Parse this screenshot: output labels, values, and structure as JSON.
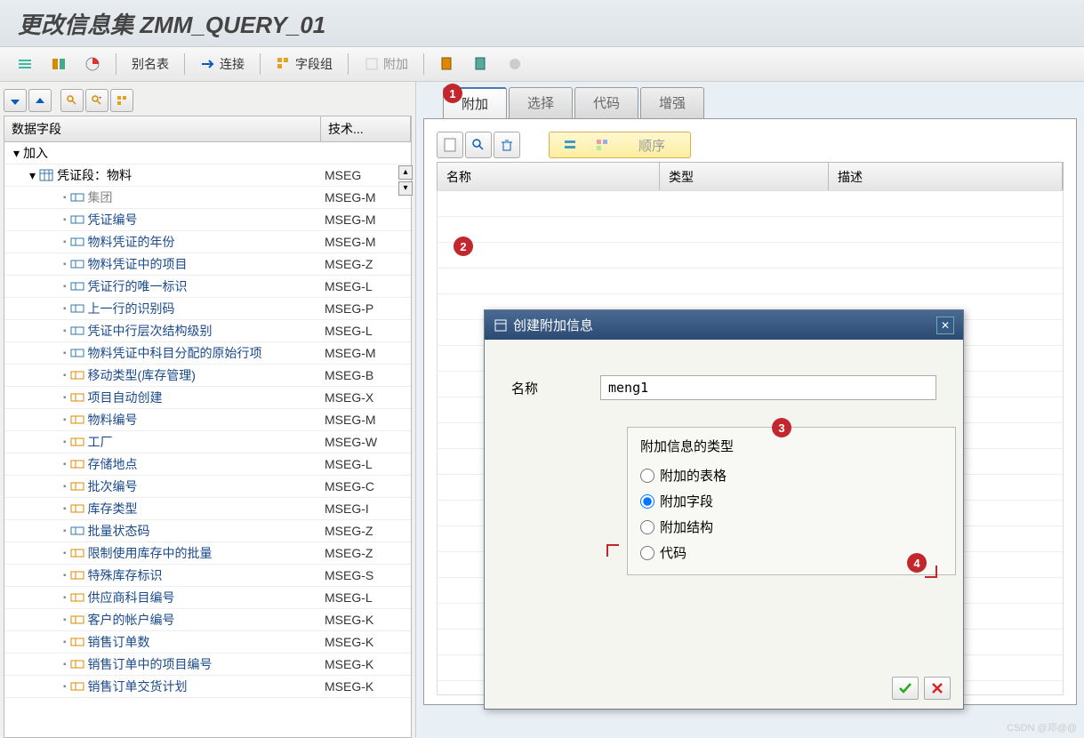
{
  "title": "更改信息集 ZMM_QUERY_01",
  "toolbar": {
    "alias_table": "别名表",
    "connect": "连接",
    "field_group": "字段组",
    "attach": "附加"
  },
  "left": {
    "header_left": "数据字段",
    "header_right": "技术...",
    "root": "加入",
    "mseg": {
      "label": "凭证段：物料",
      "tech": "MSEG"
    },
    "rows": [
      {
        "label": "集团",
        "tech": "MSEG-M",
        "gray": true
      },
      {
        "label": "凭证编号",
        "tech": "MSEG-M",
        "link": true
      },
      {
        "label": "物料凭证的年份",
        "tech": "MSEG-M",
        "link": true
      },
      {
        "label": "物料凭证中的项目",
        "tech": "MSEG-Z",
        "link": true
      },
      {
        "label": "凭证行的唯一标识",
        "tech": "MSEG-L",
        "link": true
      },
      {
        "label": "上一行的识别码",
        "tech": "MSEG-P",
        "link": true
      },
      {
        "label": "凭证中行层次结构级别",
        "tech": "MSEG-L",
        "link": true
      },
      {
        "label": "物料凭证中科目分配的原始行项",
        "tech": "MSEG-M",
        "link": true
      },
      {
        "label": "移动类型(库存管理)",
        "tech": "MSEG-B",
        "link": true,
        "iconAlt": true
      },
      {
        "label": "项目自动创建",
        "tech": "MSEG-X",
        "link": true,
        "iconAlt": true
      },
      {
        "label": "物料编号",
        "tech": "MSEG-M",
        "link": true,
        "iconAlt": true
      },
      {
        "label": "工厂",
        "tech": "MSEG-W",
        "link": true,
        "iconAlt": true
      },
      {
        "label": "存储地点",
        "tech": "MSEG-L",
        "link": true,
        "iconAlt": true
      },
      {
        "label": "批次编号",
        "tech": "MSEG-C",
        "link": true,
        "iconAlt": true
      },
      {
        "label": "库存类型",
        "tech": "MSEG-I",
        "link": true,
        "iconAlt": true
      },
      {
        "label": "批量状态码",
        "tech": "MSEG-Z",
        "link": true
      },
      {
        "label": "限制使用库存中的批量",
        "tech": "MSEG-Z",
        "link": true,
        "iconAlt": true
      },
      {
        "label": "特殊库存标识",
        "tech": "MSEG-S",
        "link": true,
        "iconAlt": true
      },
      {
        "label": "供应商科目编号",
        "tech": "MSEG-L",
        "link": true,
        "iconAlt": true
      },
      {
        "label": "客户的帐户编号",
        "tech": "MSEG-K",
        "link": true,
        "iconAlt": true
      },
      {
        "label": "销售订单数",
        "tech": "MSEG-K",
        "link": true,
        "iconAlt": true
      },
      {
        "label": "销售订单中的项目编号",
        "tech": "MSEG-K",
        "link": true,
        "iconAlt": true
      },
      {
        "label": "销售订单交货计划",
        "tech": "MSEG-K",
        "link": true,
        "iconAlt": true
      }
    ]
  },
  "tabs": [
    "附加",
    "选择",
    "代码",
    "增强"
  ],
  "grid": {
    "cols": [
      "名称",
      "类型",
      "描述"
    ],
    "seq": "顺序"
  },
  "dialog": {
    "title": "创建附加信息",
    "name_label": "名称",
    "name_value": "meng1",
    "group_title": "附加信息的类型",
    "radios": [
      "附加的表格",
      "附加字段",
      "附加结构",
      "代码"
    ],
    "selected": 1
  },
  "annotations": [
    "1",
    "2",
    "3",
    "4"
  ],
  "watermark": "CSDN @邓@@"
}
